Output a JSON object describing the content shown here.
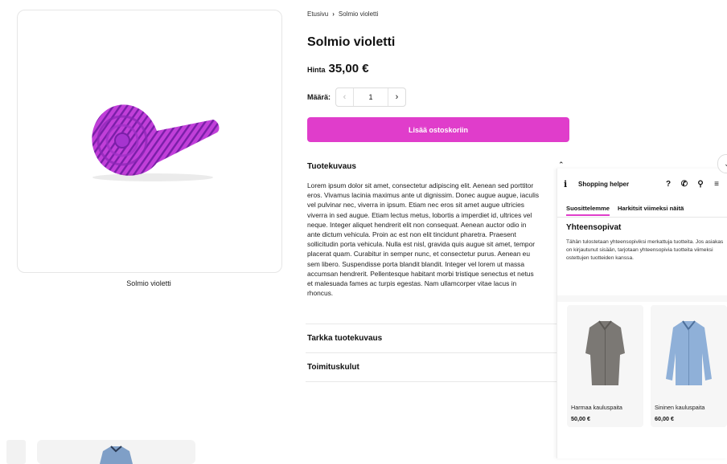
{
  "breadcrumb": {
    "home": "Etusivu",
    "separator": "›",
    "current": "Solmio violetti"
  },
  "product": {
    "title": "Solmio violetti",
    "price_label": "Hinta",
    "price": "35,00 €",
    "image_caption": "Solmio violetti",
    "quantity_label": "Määrä:",
    "quantity": "1",
    "add_to_cart": "Lisää ostoskoriin",
    "accent": "#e03dcb"
  },
  "accordion": {
    "description_title": "Tuotekuvaus",
    "description_lines": [
      "Lorem ipsum dolor sit amet, consectetur adipiscing elit. Aenean sed porttitor",
      "eros. Vivamus lacinia maximus ante ut dignissim. Donec augue augue, iaculis",
      "vel pulvinar nec, viverra in ipsum. Etiam nec eros sit amet augue ultricies",
      "viverra in sed augue. Etiam lectus metus, lobortis a imperdiet id, ultrices vel",
      "neque. Integer aliquet hendrerit elit non consequat. Aenean auctor odio in",
      "ante dictum vehicula. Proin ac est non elit tincidunt pharetra. Praesent",
      "sollicitudin porta vehicula. Nulla est nisl, gravida quis augue sit amet, tempor",
      "placerat quam. Curabitur in semper nunc, et consectetur purus. Aenean eu",
      "sem libero. Suspendisse porta blandit blandit. Integer vel lorem ut massa",
      "accumsan hendrerit. Pellentesque habitant morbi tristique senectus et netus",
      "et malesuada fames ac turpis egestas. Nam ullamcorper vitae lacus in",
      "rhoncus."
    ],
    "detailed_title": "Tarkka tuotekuvaus",
    "shipping_title": "Toimituskulut"
  },
  "helper": {
    "info_glyph": "i",
    "title": "Shopping helper",
    "icons": [
      "help-icon",
      "phone-icon",
      "search-icon",
      "menu-icon"
    ],
    "help_glyph": "?",
    "phone_glyph": "✆",
    "search_glyph": "⚲",
    "menu_glyph": "≡",
    "tabs": [
      "Suosittelemme",
      "Harkitsit viimeksi näitä"
    ],
    "section_title": "Yhteensopivat",
    "section_text": "Tähän tulostetaan yhteensopiviksi merkattuja tuotteita. Jos asiakas on kirjautunut sisään, tarjotaan yhteensopivia tuotteita viimeksi ostettujen tuotteiden kanssa.",
    "products": [
      {
        "name": "Harmaa kauluspaita",
        "price": "50,00 €",
        "color": "#7b7874"
      },
      {
        "name": "Sininen kauluspaita",
        "price": "60,00 €",
        "color": "#8fb0d8"
      }
    ]
  }
}
